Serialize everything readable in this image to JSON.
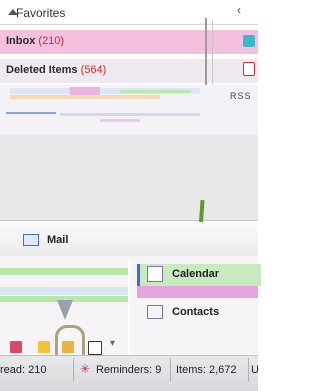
{
  "favorites": {
    "label": "Favorites"
  },
  "folders": [
    {
      "name": "Inbox",
      "count": "(210)"
    },
    {
      "name": "Deleted Items",
      "count": "(564)"
    }
  ],
  "rss": {
    "label": "RSS"
  },
  "nav": {
    "mail": "Mail",
    "calendar": "Calendar",
    "contacts": "Contacts"
  },
  "status": {
    "unread": "read: 210",
    "reminders": "Reminders: 9",
    "items": "Items: 2,672",
    "extra": "U"
  },
  "icons": {
    "collapse": "chevron-left-icon",
    "reminder": "asterisk-icon",
    "configure": "chevron-down-icon"
  },
  "colors": {
    "inbox_row": "#f3c1de",
    "calendar_row": "#c8eac0",
    "count_red": "#d02a2a"
  }
}
